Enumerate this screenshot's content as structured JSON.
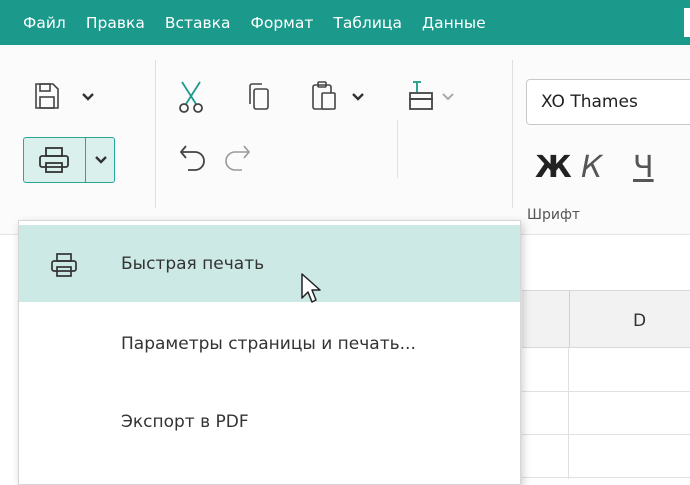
{
  "menubar": {
    "items": [
      "Файл",
      "Правка",
      "Вставка",
      "Формат",
      "Таблица",
      "Данные"
    ]
  },
  "ribbon": {
    "font_name": "XO Thames",
    "bold_label": "Ж",
    "italic_label": "К",
    "underline_label": "Ч",
    "font_group_label": "Шрифт",
    "icons": [
      "save-icon",
      "print-icon",
      "cut-icon",
      "copy-icon",
      "paste-icon",
      "format-painter-icon",
      "undo-icon",
      "redo-icon",
      "chevron-down-icon"
    ]
  },
  "sheet": {
    "column_header": "D"
  },
  "print_menu": {
    "items": [
      {
        "label": "Быстрая печать",
        "icon": "printer-icon",
        "highlighted": true
      },
      {
        "label": "Параметры страницы и печать...",
        "icon": "",
        "highlighted": false
      },
      {
        "label": "Экспорт в PDF",
        "icon": "",
        "highlighted": false
      }
    ]
  },
  "colors": {
    "accent": "#1b9a8c",
    "highlight": "#cde9e5"
  }
}
